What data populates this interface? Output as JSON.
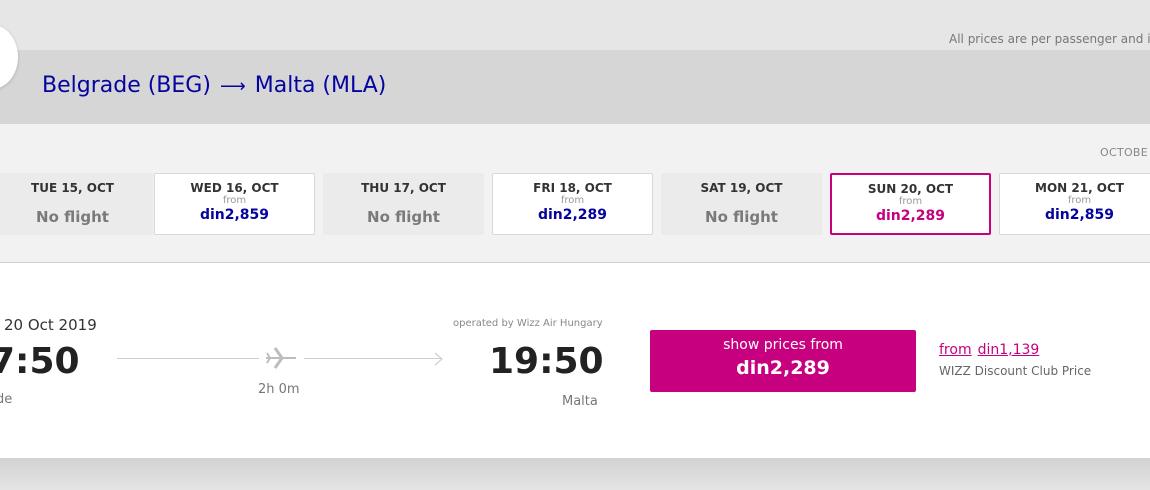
{
  "header": {
    "prices_note": "All prices are per passenger and i",
    "route": {
      "origin": "Belgrade (BEG)",
      "arrow": "⟶",
      "destination": "Malta (MLA)"
    }
  },
  "month_label": "OCTOBE",
  "dates": [
    {
      "day": "TUE 15, OCT",
      "status": "No flight"
    },
    {
      "day": "WED 16, OCT",
      "from": "from",
      "price": "din2,859"
    },
    {
      "day": "THU 17, OCT",
      "status": "No flight"
    },
    {
      "day": "FRI 18, OCT",
      "from": "from",
      "price": "din2,289"
    },
    {
      "day": "SAT 19, OCT",
      "status": "No flight"
    },
    {
      "day": "SUN 20, OCT",
      "from": "from",
      "price": "din2,289",
      "selected": true
    },
    {
      "day": "MON 21, OCT",
      "from": "from",
      "price": "din2,859"
    }
  ],
  "flight": {
    "departure": {
      "date": "20 Oct 2019",
      "time": "7:50",
      "city": "ade"
    },
    "duration": "2h 0m",
    "operated_by": "operated by Wizz Air Hungary",
    "arrival": {
      "time": "19:50",
      "city": "Malta"
    },
    "button": {
      "top_label": "show prices from",
      "price": "din2,289"
    },
    "club": {
      "from_word": "from",
      "price": "din1,139",
      "caption": "WIZZ Discount Club Price"
    }
  },
  "colors": {
    "brand_magenta": "#c6007e",
    "brand_navy": "#06049e",
    "no_flight_card": "#ebebeb"
  },
  "icons": [
    "back-icon",
    "plane-icon",
    "arrow-head-icon"
  ]
}
